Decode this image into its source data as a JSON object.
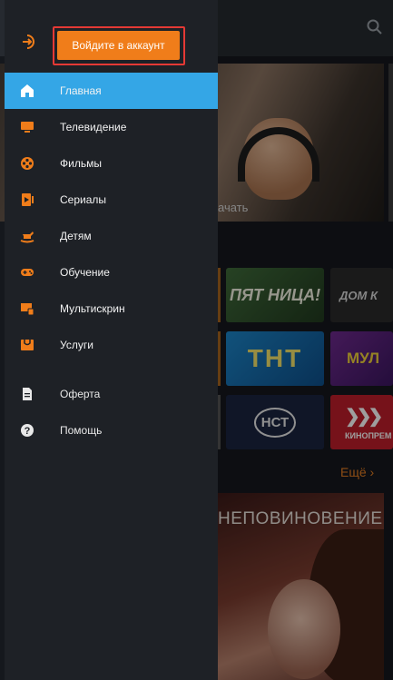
{
  "colors": {
    "accent": "#f07d1a",
    "active": "#34a6e6",
    "drawer": "#1e2126",
    "highlight": "#e53935"
  },
  "drawer": {
    "login_button": "Войдите в аккаунт",
    "login_icon": "login-icon",
    "menu": [
      {
        "label": "Главная",
        "icon": "home-icon",
        "active": true
      },
      {
        "label": "Телевидение",
        "icon": "tv-icon",
        "active": false
      },
      {
        "label": "Фильмы",
        "icon": "film-reel-icon",
        "active": false
      },
      {
        "label": "Сериалы",
        "icon": "series-icon",
        "active": false
      },
      {
        "label": "Детям",
        "icon": "rocking-horse-icon",
        "active": false
      },
      {
        "label": "Обучение",
        "icon": "gamepad-icon",
        "active": false
      },
      {
        "label": "Мультискрин",
        "icon": "multiscreen-icon",
        "active": false
      },
      {
        "label": "Услуги",
        "icon": "services-icon",
        "active": false
      }
    ],
    "secondary": [
      {
        "label": "Оферта",
        "icon": "document-icon"
      },
      {
        "label": "Помощь",
        "icon": "help-icon"
      }
    ]
  },
  "background": {
    "search_icon": "search-icon",
    "hero_caption": "ачать",
    "channels": {
      "pyatnica": "ПЯТ НИЦА!",
      "domkino": "ДОМ К",
      "tnt": "ТНТ",
      "mult": "МУЛ",
      "nst": "НСТ",
      "kino": "КИНОПРЕМ"
    },
    "more_link": "Ещё ›",
    "promo_title": "НЕПОВИНОВЕНИЕ"
  }
}
